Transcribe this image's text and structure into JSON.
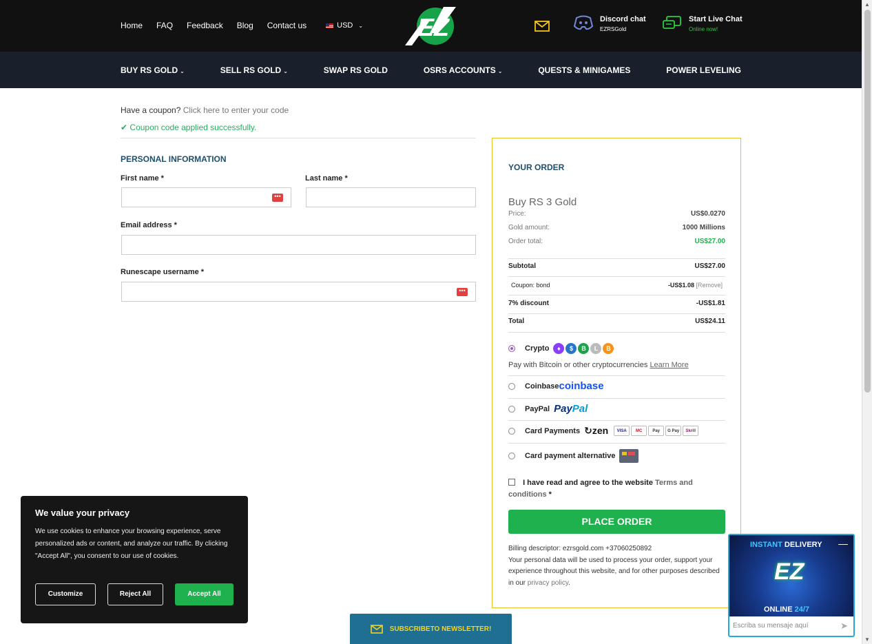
{
  "header": {
    "nav": [
      "Home",
      "FAQ",
      "Feedback",
      "Blog",
      "Contact us"
    ],
    "currency": "USD",
    "logo_text": "EZ",
    "discord": {
      "title": "Discord chat",
      "sub": "EZRSGold"
    },
    "livechat": {
      "title": "Start Live Chat",
      "sub": "Online now!"
    }
  },
  "mainnav": [
    "BUY RS GOLD",
    "SELL RS GOLD",
    "SWAP RS GOLD",
    "OSRS ACCOUNTS",
    "QUESTS & MINIGAMES",
    "POWER LEVELING"
  ],
  "coupon": {
    "prompt": "Have a coupon?",
    "link": "Click here to enter your code",
    "success": "Coupon code applied successfully."
  },
  "personal": {
    "title": "PERSONAL INFORMATION",
    "first_name": "First name *",
    "last_name": "Last name *",
    "email": "Email address *",
    "username": "Runescape username *"
  },
  "order": {
    "title": "YOUR ORDER",
    "product": "Buy RS 3 Gold",
    "price_label": "Price:",
    "price": "US$0.0270",
    "gold_label": "Gold amount:",
    "gold": "1000 Millions",
    "total_label": "Order total:",
    "total": "US$27.00",
    "subtotal_label": "Subtotal",
    "subtotal": "US$27.00",
    "coupon_label": "Coupon: bond",
    "coupon_value": "-US$1.08",
    "remove": "[Remove]",
    "discount_label": "7% discount",
    "discount": "-US$1.81",
    "grand_label": "Total",
    "grand": "US$24.11"
  },
  "payment": {
    "crypto": "Crypto",
    "crypto_desc": "Pay with Bitcoin or other cryptocurrencies",
    "learn_more": "Learn More",
    "coinbase": "Coinbase",
    "coinbase_logo": "coinbase",
    "paypal": "PayPal",
    "paypal_logo_a": "Pay",
    "paypal_logo_b": "Pal",
    "card": "Card Payments",
    "zen_logo": "zen",
    "card_badges": [
      "VISA",
      "MC",
      "Pay",
      "G Pay",
      "Skrill"
    ],
    "card_alt": "Card payment alternative"
  },
  "terms": {
    "text": "I have read and agree to the website",
    "link": "Terms and conditions",
    "asterisk": "*"
  },
  "place_order": "PLACE ORDER",
  "billing": {
    "line1": "Billing descriptor: ezrsgold.com +37060250892",
    "line2": "Your personal data will be used to process your order, support your experience throughout this website, and for other purposes described in our",
    "privacy": "privacy policy",
    "end": "."
  },
  "cookie": {
    "title": "We value your privacy",
    "body": "We use cookies to enhance your browsing experience, serve personalized ads or content, and analyze our traffic. By clicking \"Accept All\", you consent to our use of cookies.",
    "customize": "Customize",
    "reject": "Reject All",
    "accept": "Accept All"
  },
  "newsletter": "SUBSCRIBETO NEWSLETTER!",
  "chat": {
    "title_a": "INSTANT",
    "title_b": "DELIVERY",
    "logo": "EZ",
    "online_a": "ONLINE",
    "online_b": "24/7",
    "placeholder": "Escriba su mensaje aquí"
  },
  "colors": {
    "accent_green": "#1fb14d",
    "title_blue": "#1c4f6e",
    "order_border": "#e8c12a",
    "header_bg": "#111111",
    "nav_bg": "#1a202b"
  }
}
